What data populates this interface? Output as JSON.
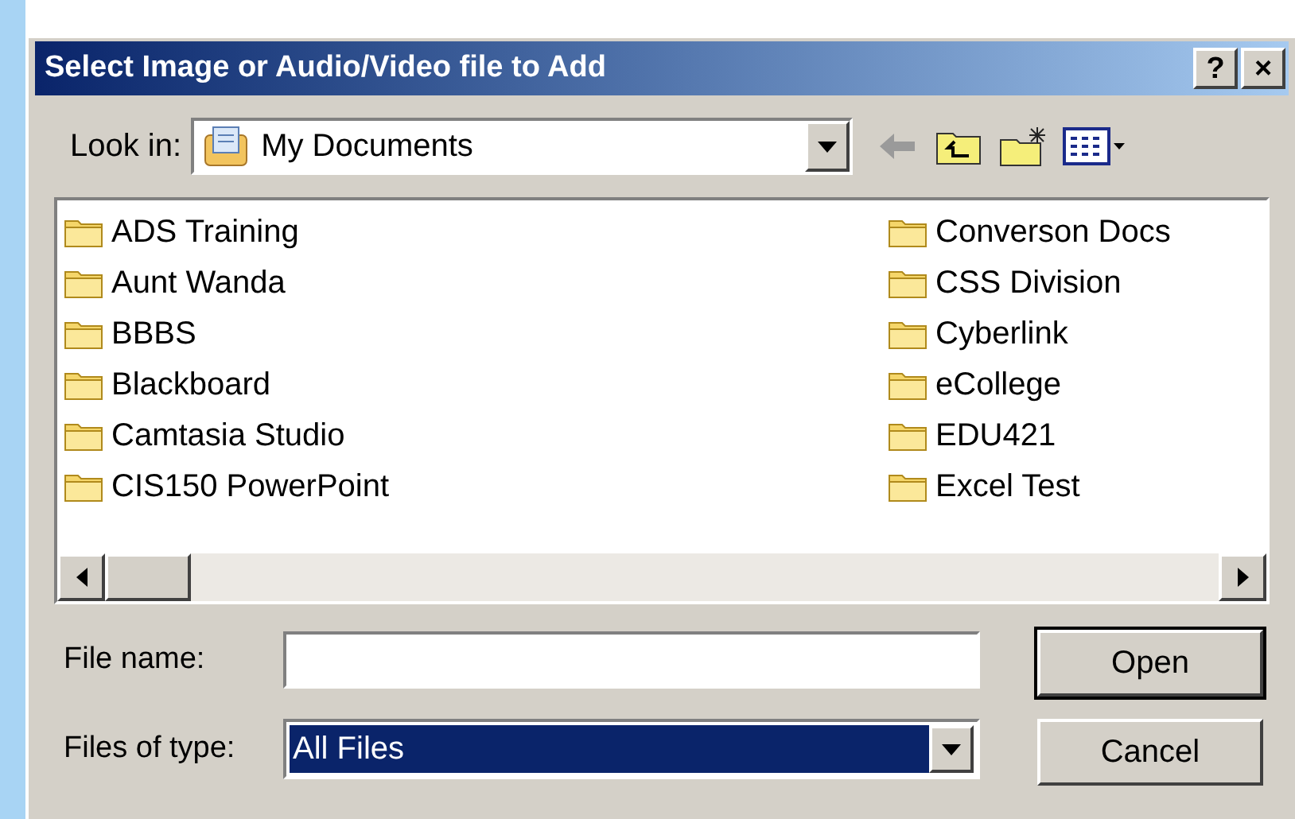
{
  "window": {
    "title": "Select Image or Audio/Video file to Add",
    "title_buttons": [
      "?",
      "×"
    ]
  },
  "look_in": {
    "label": "Look in:",
    "value": "My Documents"
  },
  "folders": [
    {
      "name": "ADS Training"
    },
    {
      "name": "Aunt Wanda"
    },
    {
      "name": "BBBS"
    },
    {
      "name": "Blackboard"
    },
    {
      "name": "Camtasia Studio"
    },
    {
      "name": "CIS150 PowerPoint"
    },
    {
      "name": "Converson Docs"
    },
    {
      "name": "CSS Division"
    },
    {
      "name": "Cyberlink"
    },
    {
      "name": "eCollege"
    },
    {
      "name": "EDU421"
    },
    {
      "name": "Excel Test"
    }
  ],
  "file_name": {
    "label": "File name:"
  },
  "files_of_type": {
    "label": "Files of type:",
    "value": "All Files",
    "selected": true
  },
  "buttons": [
    {
      "label": "Open",
      "default": true
    },
    {
      "label": "Cancel",
      "default": false
    }
  ]
}
